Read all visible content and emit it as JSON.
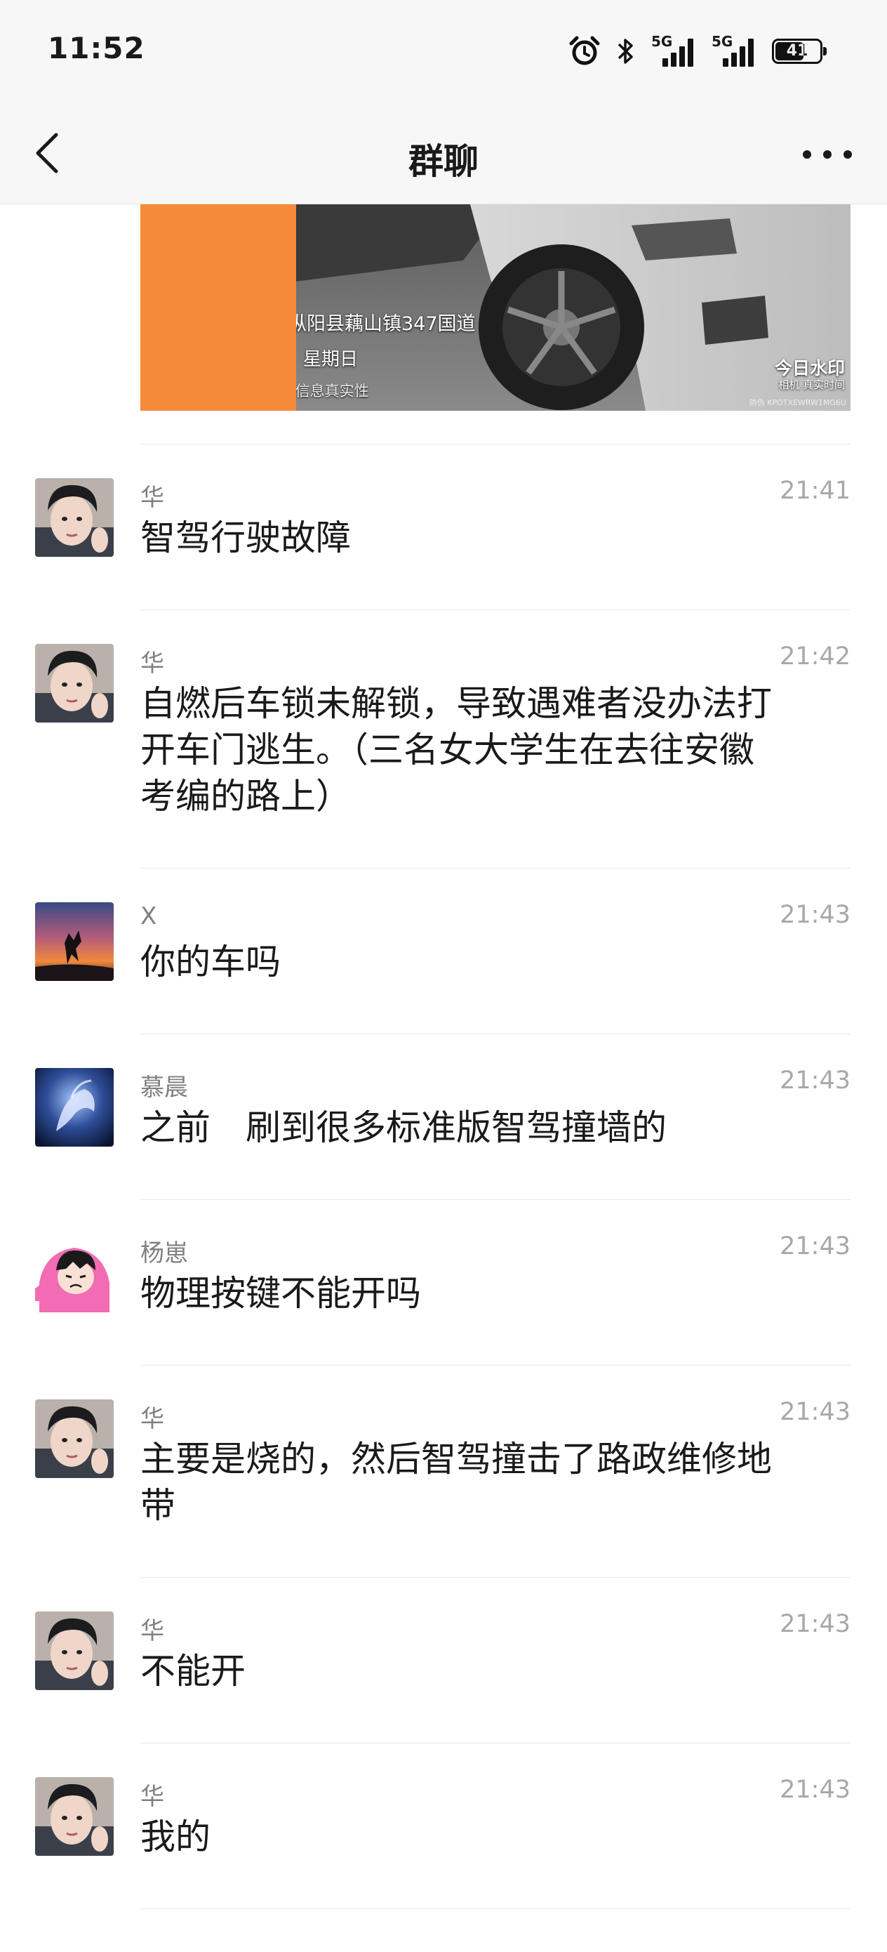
{
  "status_bar": {
    "time": "11:52",
    "network_1": "5G",
    "network_2": "5G",
    "battery": "41",
    "icons": [
      "alarm-icon",
      "bluetooth-icon",
      "signal-icon",
      "signal-icon",
      "battery-icon"
    ]
  },
  "nav": {
    "title": "群聊",
    "back_icon": "chevron-left-icon",
    "more_icon": "more-dots-icon"
  },
  "image_message": {
    "watermark_address": "枞阳县藕山镇347国道",
    "watermark_day": "星期日",
    "watermark_note": "相机    考勤信息真实性",
    "logo_line1": "今日水印",
    "logo_line2": "相机 真实时间",
    "code": "防伪 KPOTXEWRW1MG6U"
  },
  "messages": [
    {
      "sender": "华",
      "time": "21:41",
      "lines": [
        "智驾行驶故障"
      ]
    },
    {
      "sender": "华",
      "time": "21:42",
      "lines": [
        "自燃后车锁未解锁，导致遇难者没办法打",
        "开车门逃生。（三名女大学生在去往安徽",
        "考编的路上）"
      ]
    },
    {
      "sender": "X",
      "time": "21:43",
      "lines": [
        "你的车吗"
      ]
    },
    {
      "sender": "慕晨",
      "time": "21:43",
      "lines": [
        "之前　刷到很多标准版智驾撞墙的"
      ]
    },
    {
      "sender": "杨崽",
      "time": "21:43",
      "lines": [
        "物理按键不能开吗"
      ]
    },
    {
      "sender": "华",
      "time": "21:43",
      "lines": [
        "主要是烧的，然后智驾撞击了路政维修地",
        "带"
      ]
    },
    {
      "sender": "华",
      "time": "21:43",
      "lines": [
        "不能开"
      ]
    },
    {
      "sender": "华",
      "time": "21:43",
      "lines": [
        "我的"
      ]
    }
  ],
  "colors": {
    "background": "#ffffff",
    "bar_background": "#f7f7f7",
    "sender": "#808080",
    "time": "#a8a8a8",
    "redaction": "#f58a3a"
  }
}
